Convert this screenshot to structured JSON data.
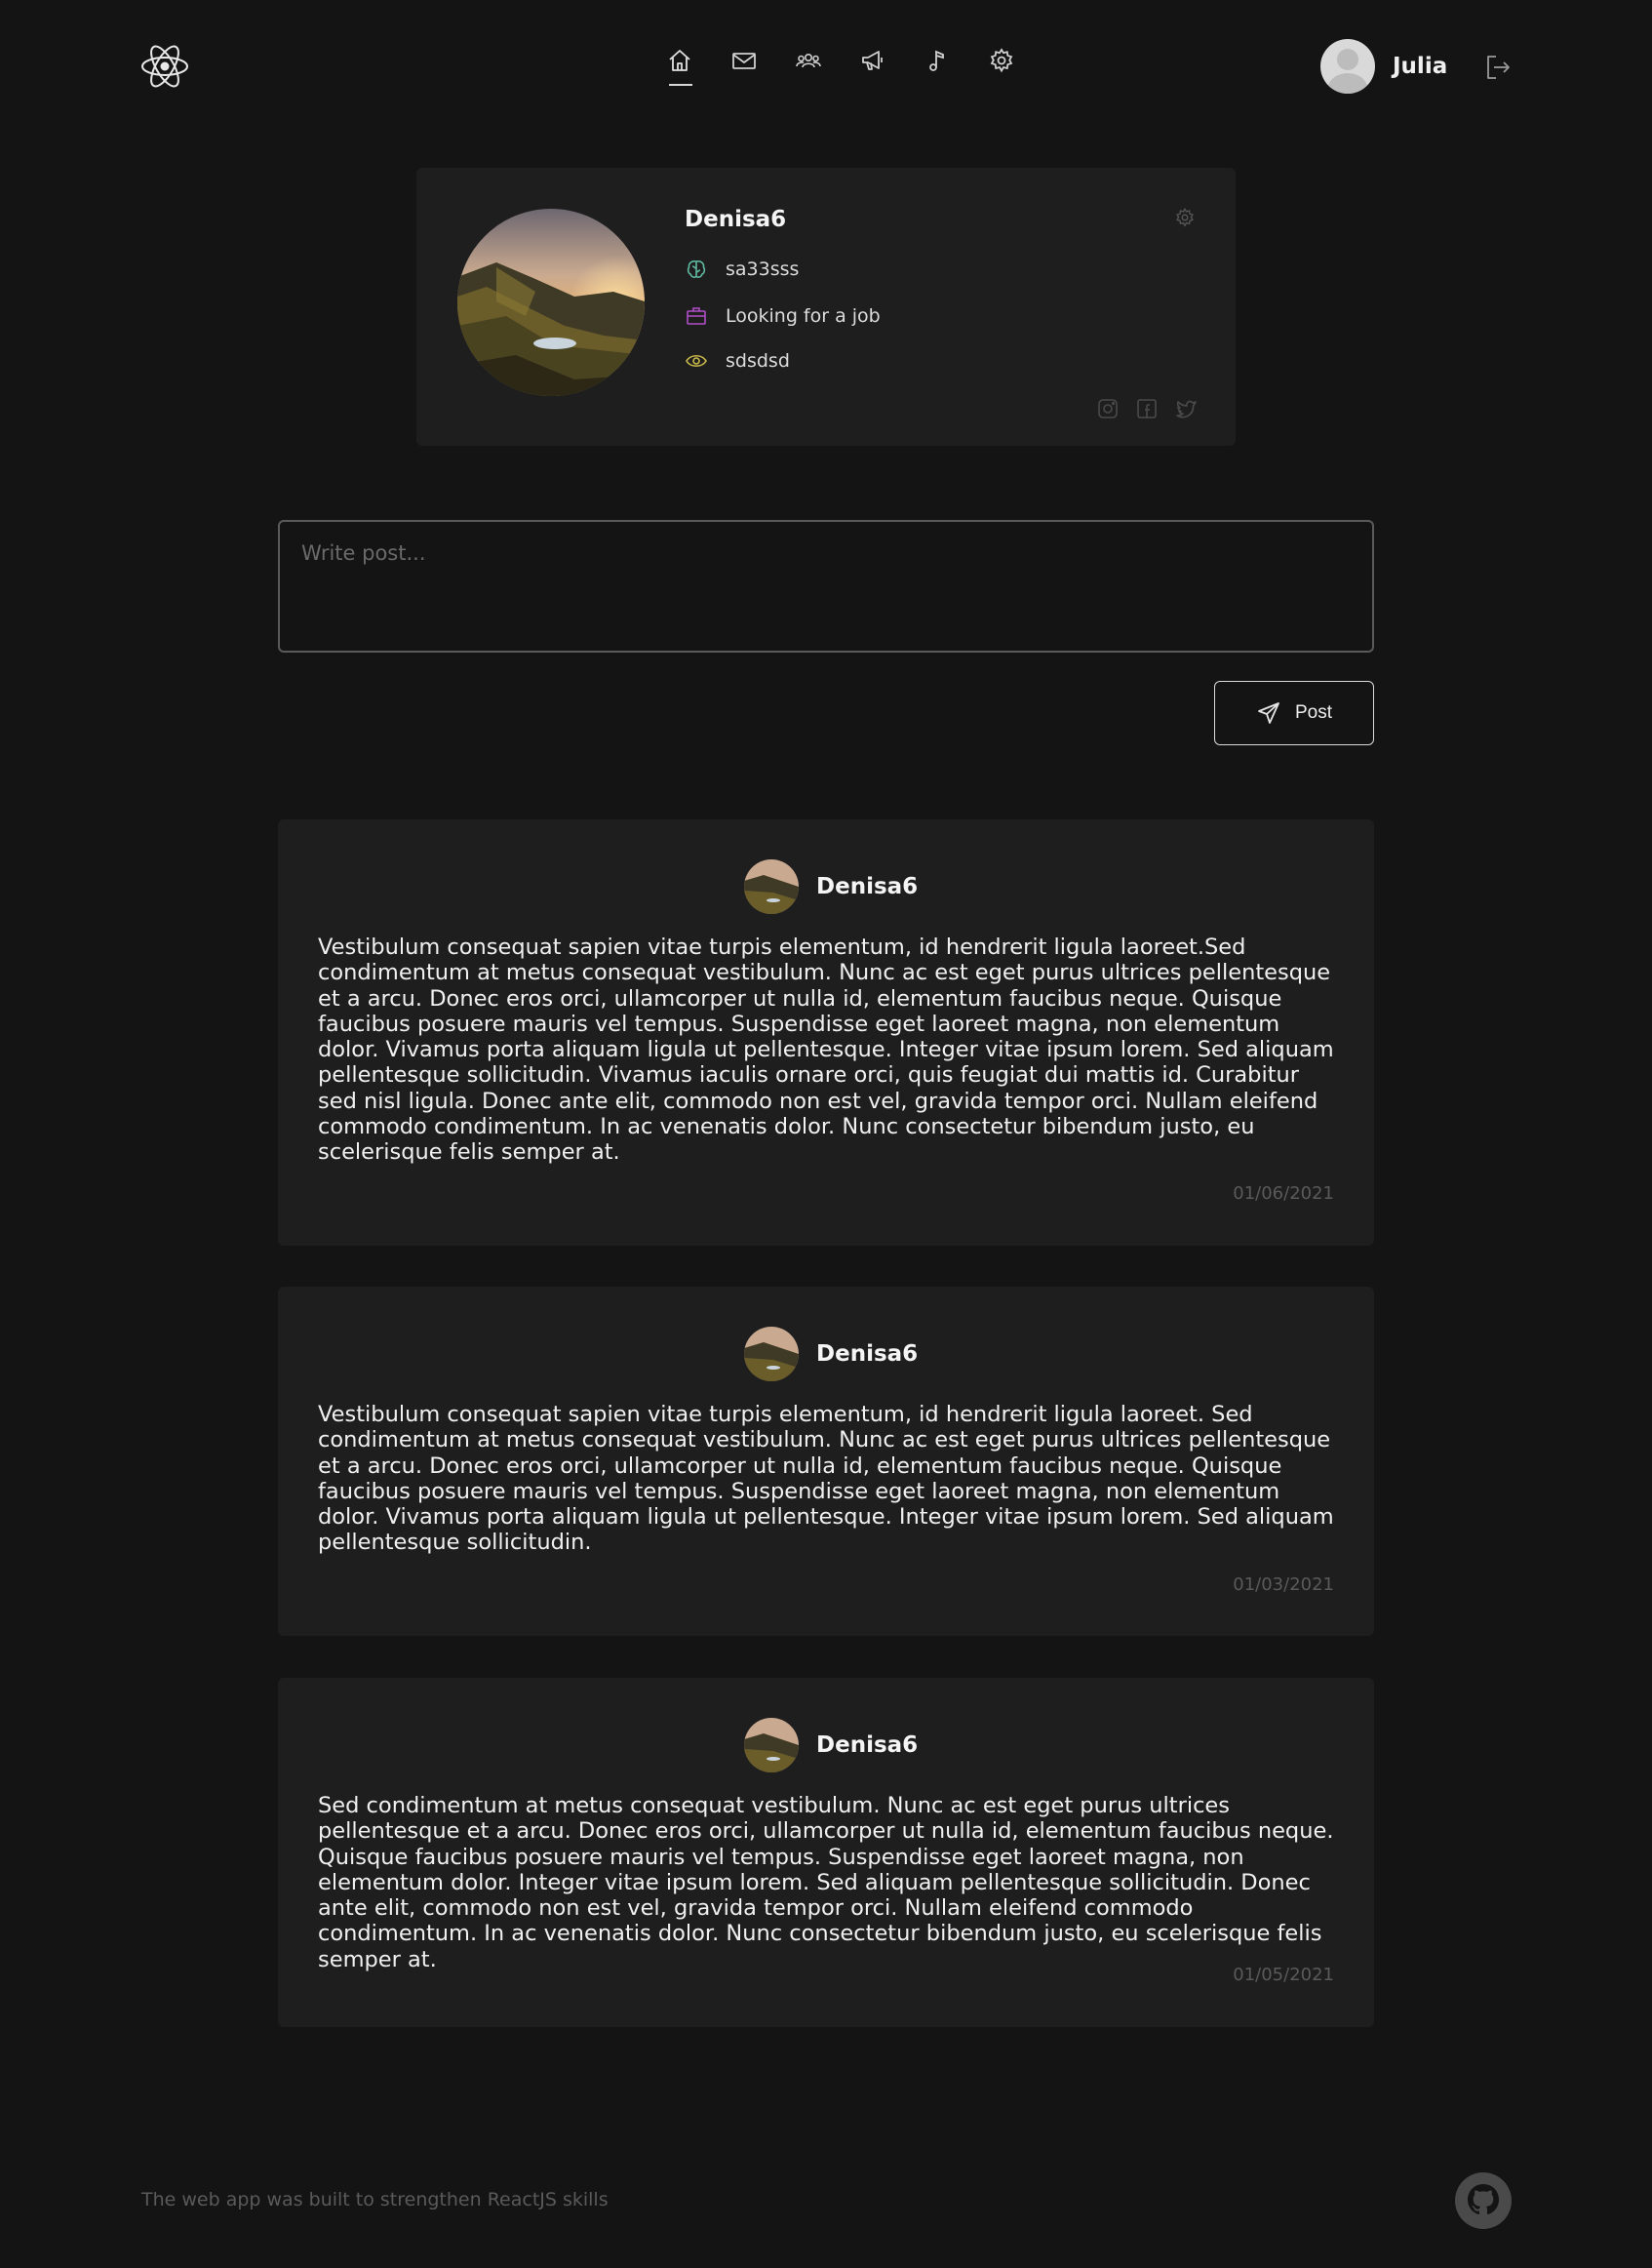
{
  "header": {
    "nav": [
      {
        "icon": "home-icon",
        "active": true
      },
      {
        "icon": "mail-icon",
        "active": false
      },
      {
        "icon": "users-icon",
        "active": false
      },
      {
        "icon": "megaphone-icon",
        "active": false
      },
      {
        "icon": "music-icon",
        "active": false
      },
      {
        "icon": "settings-icon",
        "active": false
      }
    ],
    "user_name": "Julia"
  },
  "profile": {
    "name": "Denisa6",
    "about": "sa33sss",
    "job_status": "Looking for a job",
    "looking_for_job_description": "sdsdsd"
  },
  "composer": {
    "placeholder": "Write post...",
    "post_label": "Post"
  },
  "posts": [
    {
      "author": "Denisa6",
      "text": "Vestibulum consequat sapien vitae turpis elementum, id hendrerit ligula laoreet.Sed condimentum at metus consequat vestibulum. Nunc ac est eget purus ultrices pellentesque et a arcu. Donec eros orci, ullamcorper ut nulla id, elementum faucibus neque. Quisque faucibus posuere mauris vel tempus. Suspendisse eget laoreet magna, non elementum dolor. Vivamus porta aliquam ligula ut pellentesque. Integer vitae ipsum lorem. Sed aliquam pellentesque sollicitudin. Vivamus iaculis ornare orci, quis feugiat dui mattis id. Curabitur sed nisl ligula. Donec ante elit, commodo non est vel, gravida tempor orci. Nullam eleifend commodo condimentum. In ac venenatis dolor. Nunc consectetur bibendum justo, eu scelerisque felis semper at.",
      "date": "01/06/2021"
    },
    {
      "author": "Denisa6",
      "text": "Vestibulum consequat sapien vitae turpis elementum, id hendrerit ligula laoreet. Sed condimentum at metus consequat vestibulum. Nunc ac est eget purus ultrices pellentesque et a arcu. Donec eros orci, ullamcorper ut nulla id, elementum faucibus neque. Quisque faucibus posuere mauris vel tempus. Suspendisse eget laoreet magna, non elementum dolor. Vivamus porta aliquam ligula ut pellentesque. Integer vitae ipsum lorem. Sed aliquam pellentesque sollicitudin.",
      "date": "01/03/2021"
    },
    {
      "author": "Denisa6",
      "text": "Sed condimentum at metus consequat vestibulum. Nunc ac est eget purus ultrices pellentesque et a arcu. Donec eros orci, ullamcorper ut nulla id, elementum faucibus neque. Quisque faucibus posuere mauris vel tempus. Suspendisse eget laoreet magna, non elementum dolor. Integer vitae ipsum lorem. Sed aliquam pellentesque sollicitudin. Donec ante elit, commodo non est vel, gravida tempor orci. Nullam eleifend commodo condimentum. In ac venenatis dolor. Nunc consectetur bibendum justo, eu scelerisque felis semper at.",
      "date": "01/05/2021"
    }
  ],
  "footer": {
    "text": "The web app was built to strengthen ReactJS skills"
  },
  "colors": {
    "background": "#141414",
    "card": "#1e1e1e",
    "about_icon": "#5fb8a0",
    "job_icon": "#b04fc9",
    "eye_icon": "#c8b84a"
  }
}
